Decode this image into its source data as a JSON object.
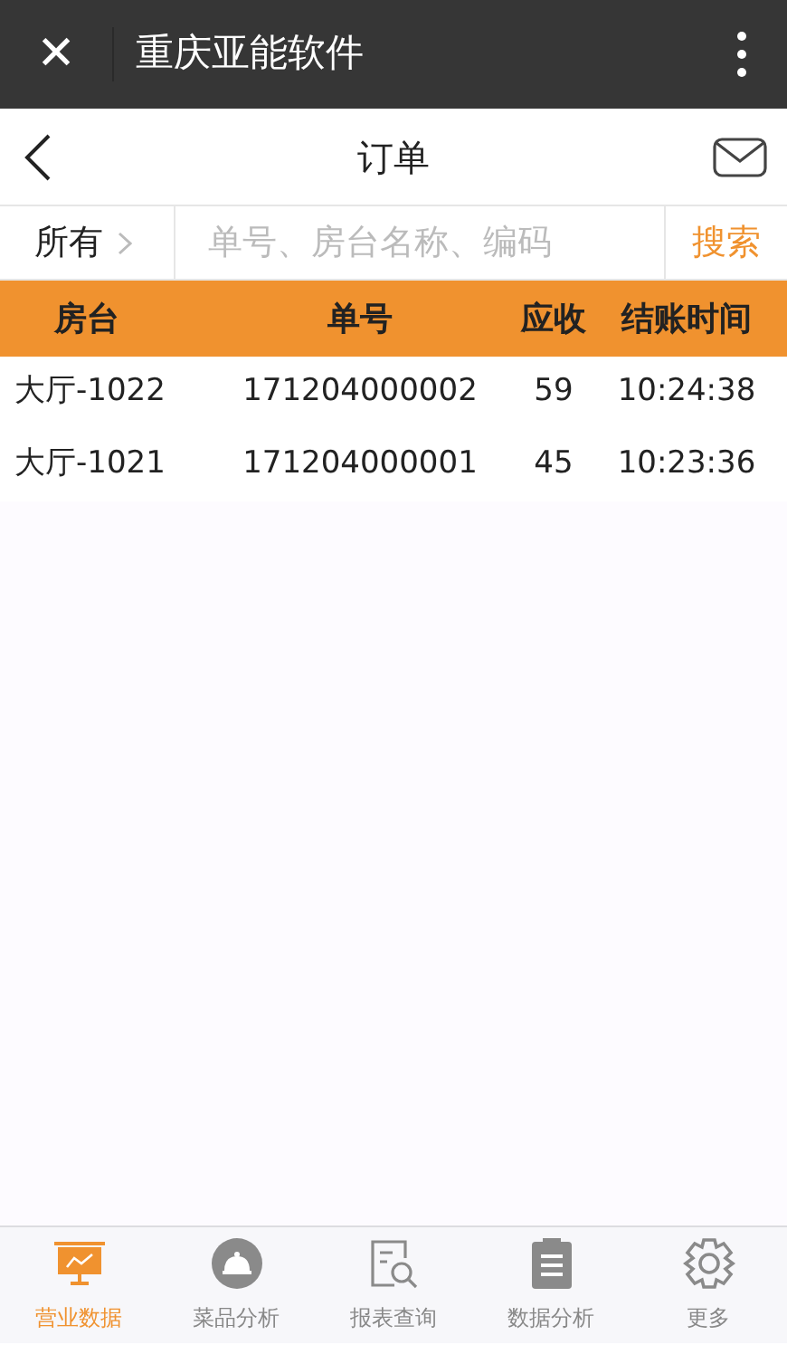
{
  "title_bar": {
    "close": "✕",
    "title": "重庆亚能软件"
  },
  "header": {
    "title": "订单"
  },
  "search": {
    "filter": "所有",
    "placeholder": "单号、房台名称、编码",
    "button": "搜索"
  },
  "table": {
    "columns": [
      "房台",
      "单号",
      "应收",
      "结账时间"
    ],
    "rows": [
      [
        "大厅-1022",
        "171204000002",
        "59",
        "10:24:38"
      ],
      [
        "大厅-1021",
        "171204000001",
        "45",
        "10:23:36"
      ]
    ]
  },
  "tabs": [
    {
      "label": "营业数据",
      "selected": true
    },
    {
      "label": "菜品分析",
      "selected": false
    },
    {
      "label": "报表查询",
      "selected": false
    },
    {
      "label": "数据分析",
      "selected": false
    },
    {
      "label": "更多",
      "selected": false
    }
  ]
}
